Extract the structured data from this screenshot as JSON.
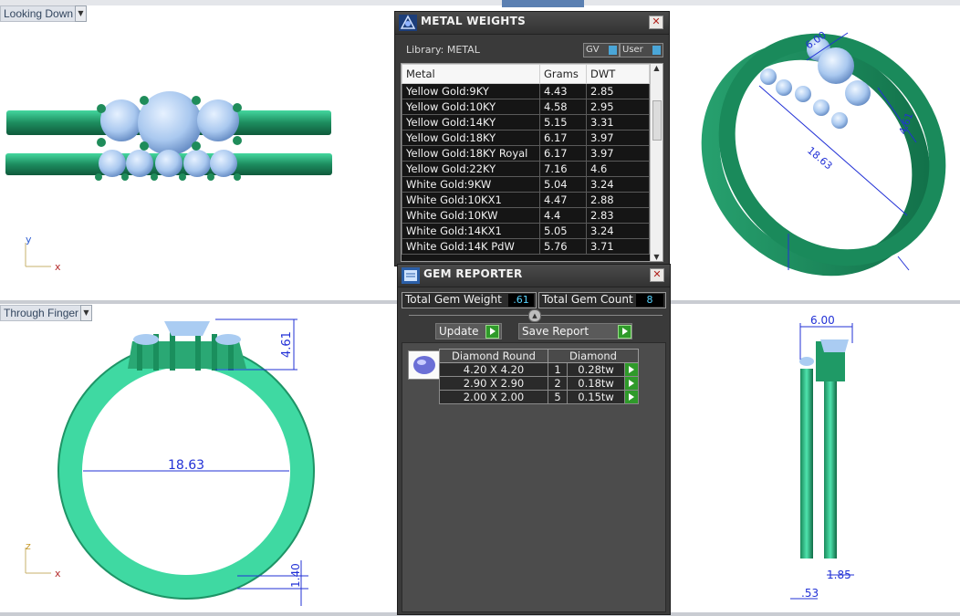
{
  "viewports": {
    "top_left": {
      "label": "Looking Down",
      "axis_a": "y",
      "axis_b": "x"
    },
    "bottom_left": {
      "label": "Through Finger",
      "axis_a": "z",
      "axis_b": "x",
      "dimension_inner": "18.63",
      "dimension_height": "4.61",
      "dimension_band": "1.40"
    },
    "top_right": {
      "dimension_a": "6.00",
      "dimension_b": "18.63",
      "dimension_c": "4.61"
    },
    "bottom_right": {
      "dimension_width": "6.00",
      "dimension_left": ".53",
      "dimension_right": "1.85"
    }
  },
  "metal_weights": {
    "title": "METAL WEIGHTS",
    "library": "Library: METAL",
    "gv_label": "GV",
    "user_label": "User",
    "columns": [
      "Metal",
      "Grams",
      "DWT"
    ],
    "rows": [
      {
        "metal": "Yellow Gold:9KY",
        "grams": "4.43",
        "dwt": "2.85"
      },
      {
        "metal": "Yellow Gold:10KY",
        "grams": "4.58",
        "dwt": "2.95"
      },
      {
        "metal": "Yellow Gold:14KY",
        "grams": "5.15",
        "dwt": "3.31"
      },
      {
        "metal": "Yellow Gold:18KY",
        "grams": "6.17",
        "dwt": "3.97"
      },
      {
        "metal": "Yellow Gold:18KY Royal",
        "grams": "6.17",
        "dwt": "3.97"
      },
      {
        "metal": "Yellow Gold:22KY",
        "grams": "7.16",
        "dwt": "4.6"
      },
      {
        "metal": "White Gold:9KW",
        "grams": "5.04",
        "dwt": "3.24"
      },
      {
        "metal": "White Gold:10KX1",
        "grams": "4.47",
        "dwt": "2.88"
      },
      {
        "metal": "White Gold:10KW",
        "grams": "4.4",
        "dwt": "2.83"
      },
      {
        "metal": "White Gold:14KX1",
        "grams": "5.05",
        "dwt": "3.24"
      },
      {
        "metal": "White Gold:14K PdW",
        "grams": "5.76",
        "dwt": "3.71"
      }
    ]
  },
  "gem_reporter": {
    "title": "GEM REPORTER",
    "total_weight_label": "Total Gem Weight",
    "total_weight_value": ".61",
    "total_count_label": "Total Gem Count",
    "total_count_value": "8",
    "update_label": "Update",
    "save_label": "Save Report",
    "table_headers": [
      "Diamond Round",
      "Diamond"
    ],
    "rows": [
      {
        "size": "4.20 X 4.20",
        "count": "1",
        "weight": "0.28tw"
      },
      {
        "size": "2.90 X 2.90",
        "count": "2",
        "weight": "0.18tw"
      },
      {
        "size": "2.00 X 2.00",
        "count": "5",
        "weight": "0.15tw"
      }
    ]
  },
  "colors": {
    "ring_green": "#1f8f62",
    "ring_light": "#3fd7a0",
    "gem_blue": "#aaccf2",
    "dimension_blue": "#2231d6"
  }
}
